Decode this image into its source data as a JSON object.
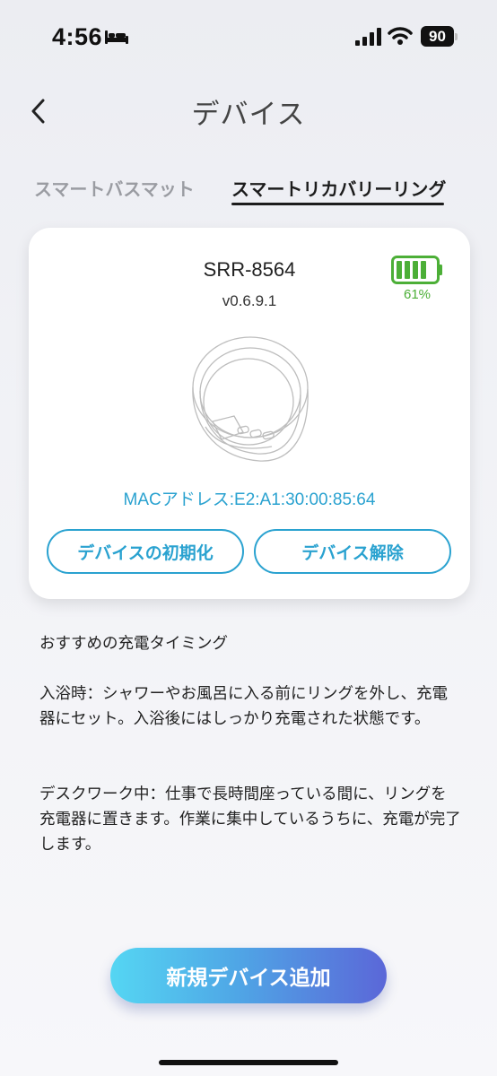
{
  "status_bar": {
    "time": "4:56",
    "battery_level": "90",
    "icons": [
      "bed-icon",
      "signal-icon",
      "wifi-icon",
      "battery-icon"
    ]
  },
  "header": {
    "title": "デバイス",
    "back_icon": "chevron-left-icon"
  },
  "tabs": [
    {
      "label": "スマートバスマット",
      "active": false
    },
    {
      "label": "スマートリカバリーリング",
      "active": true
    }
  ],
  "device": {
    "name": "SRR-8564",
    "version": "v0.6.9.1",
    "battery_percent": "61%",
    "battery_value": 0.61,
    "battery_color": "#4caf37",
    "image_icon": "smart-ring-image",
    "mac_address": "MACアドレス:E2:A1:30:00:85:64",
    "reset_label": "デバイスの初期化",
    "unpair_label": "デバイス解除"
  },
  "charging_tips": {
    "heading": "おすすめの充電タイミング",
    "bath": "入浴時：シャワーやお風呂に入る前にリングを外し、充電器にセット。入浴後にはしっかり充電された状態です。",
    "desk": "デスクワーク中：仕事で長時間座っている間に、リングを充電器に置きます。作業に集中しているうちに、充電が完了します。"
  },
  "add_device_label": "新規デバイス追加",
  "colors": {
    "accent": "#2aa2d0",
    "gradient_start": "#55d6f3",
    "gradient_end": "#5b67d8"
  }
}
